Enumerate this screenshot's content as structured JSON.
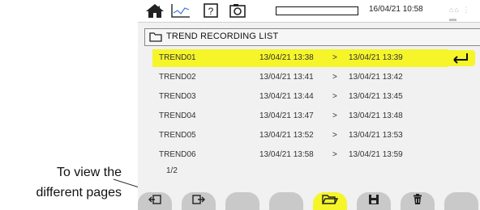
{
  "callout": {
    "line1": "To view the",
    "line2": "different pages"
  },
  "status_bar": {
    "icons": [
      "home-icon",
      "trend-chart-icon",
      "help-icon",
      "camera-icon"
    ],
    "datetime": "16/04/21 10:58",
    "indicators": "⌂⌂ ⋮ ▬"
  },
  "header": {
    "icon": "folder-icon",
    "title": "TREND RECORDING LIST"
  },
  "recordings": [
    {
      "name": "TREND01",
      "start": "13/04/21 13:38",
      "arrow": ">",
      "end": "13/04/21 13:39",
      "selected": true
    },
    {
      "name": "TREND02",
      "start": "13/04/21 13:41",
      "arrow": ">",
      "end": "13/04/21 13:42",
      "selected": false
    },
    {
      "name": "TREND03",
      "start": "13/04/21 13:44",
      "arrow": ">",
      "end": "13/04/21 13:45",
      "selected": false
    },
    {
      "name": "TREND04",
      "start": "13/04/21 13:47",
      "arrow": ">",
      "end": "13/04/21 13:48",
      "selected": false
    },
    {
      "name": "TREND05",
      "start": "13/04/21 13:52",
      "arrow": ">",
      "end": "13/04/21 13:53",
      "selected": false
    },
    {
      "name": "TREND06",
      "start": "13/04/21 13:58",
      "arrow": ">",
      "end": "13/04/21 13:59",
      "selected": false
    }
  ],
  "page_indicator": "1/2",
  "softkeys": [
    {
      "icon": "previous-page-icon",
      "active": false
    },
    {
      "icon": "next-page-icon",
      "active": false
    },
    {
      "icon": "",
      "active": false
    },
    {
      "icon": "",
      "active": false
    },
    {
      "icon": "open-folder-icon",
      "active": true
    },
    {
      "icon": "save-icon",
      "active": false
    },
    {
      "icon": "trash-icon",
      "active": false
    },
    {
      "icon": "",
      "active": false
    }
  ],
  "colors": {
    "selection": "#f5f52a",
    "softkey": "#c9c9c9",
    "background": "#f1f1f1"
  }
}
